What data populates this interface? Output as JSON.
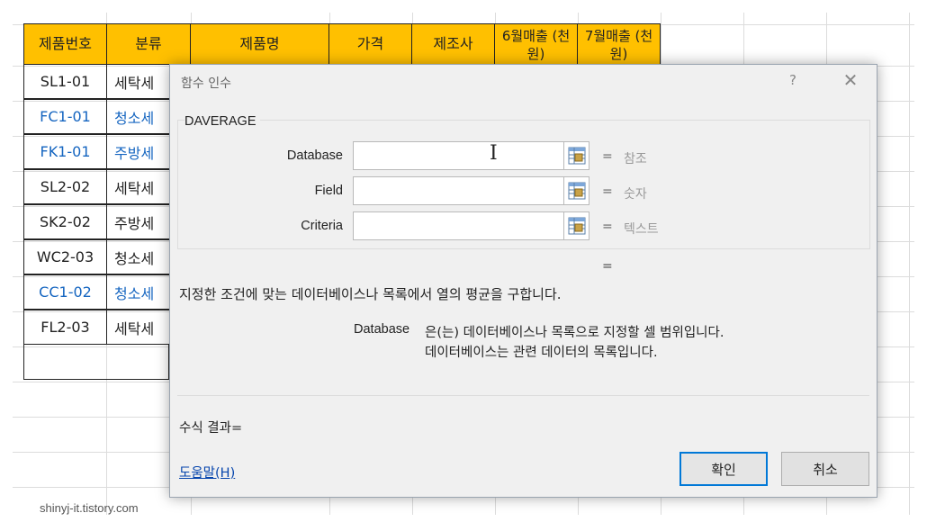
{
  "sheet": {
    "headers": [
      "제품번호",
      "분류",
      "제품명",
      "가격",
      "제조사",
      "6월매출 (천원)",
      "7월매출 (천원)"
    ],
    "rows": [
      {
        "code": "SL1-01",
        "category": "세탁세",
        "blue": false
      },
      {
        "code": "FC1-01",
        "category": "청소세",
        "blue": true
      },
      {
        "code": "FK1-01",
        "category": "주방세",
        "blue": true
      },
      {
        "code": "SL2-02",
        "category": "세탁세",
        "blue": false
      },
      {
        "code": "SK2-02",
        "category": "주방세",
        "blue": false
      },
      {
        "code": "WC2-03",
        "category": "청소세",
        "blue": false
      },
      {
        "code": "CC1-02",
        "category": "청소세",
        "blue": true
      },
      {
        "code": "FL2-03",
        "category": "세탁세",
        "blue": false
      }
    ],
    "header_color": "#ffc000",
    "blue_text_color": "#1565c0"
  },
  "watermark": "shinyj-it.tistory.com",
  "dialog": {
    "title": "함수 인수",
    "help_glyph": "?",
    "close_glyph": "✕",
    "function_name": "DAVERAGE",
    "args": [
      {
        "label": "Database",
        "value": "",
        "hint": "참조"
      },
      {
        "label": "Field",
        "value": "",
        "hint": "숫자"
      },
      {
        "label": "Criteria",
        "value": "",
        "hint": "텍스트"
      }
    ],
    "equals": "=",
    "result_equals": "=",
    "description": "지정한 조건에 맞는 데이터베이스나 목록에서 열의 평균을 구합니다.",
    "arg_name": "Database",
    "arg_desc_line1": "은(는) 데이터베이스나 목록으로 지정할 셀 범위입니다.",
    "arg_desc_line2": "데이터베이스는 관련 데이터의 목록입니다.",
    "formula_result": "수식 결과=",
    "help_link": "도움말(H)",
    "ok_label": "확인",
    "cancel_label": "취소",
    "ref_icon": "range-select-icon"
  }
}
